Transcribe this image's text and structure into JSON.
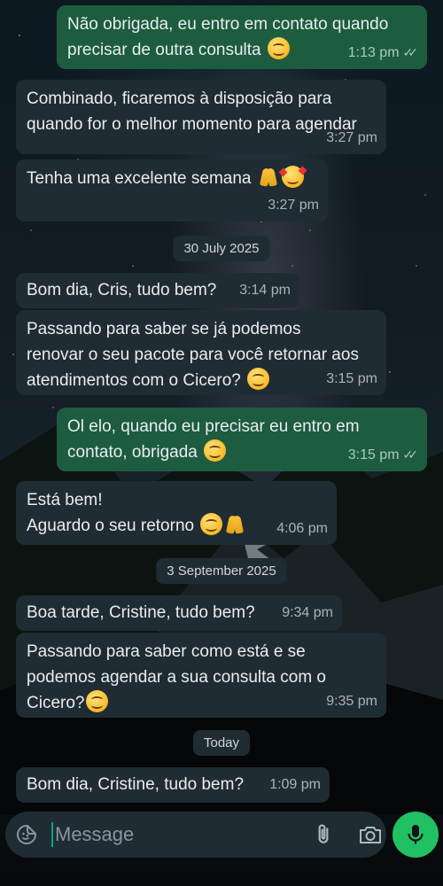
{
  "messages": [
    {
      "dir": "out",
      "text": "Não obrigada, eu entro em contato quando\nprecisar de outra consulta",
      "emojis": [
        "smile"
      ],
      "time": "1:13 pm",
      "read": true
    },
    {
      "dir": "in",
      "text": "Combinado, ficaremos à disposição para\nquando for o melhor momento para agendar",
      "emojis": [],
      "time": "3:27 pm"
    },
    {
      "dir": "in",
      "text": "Tenha uma excelente semana",
      "emojis": [
        "pray",
        "love"
      ],
      "time": "3:27 pm"
    },
    {
      "dir": "in",
      "text": "Bom dia, Cris, tudo bem?",
      "emojis": [],
      "time": "3:14 pm"
    },
    {
      "dir": "in",
      "text": "Passando para saber se já podemos\nrenovar o seu pacote para você retornar aos\natendimentos com o Cicero?",
      "emojis": [
        "smile"
      ],
      "time": "3:15 pm"
    },
    {
      "dir": "out",
      "text": "Ol elo, quando eu precisar eu entro em\ncontato, obrigada",
      "emojis": [
        "smile"
      ],
      "time": "3:15 pm",
      "read": true
    },
    {
      "dir": "in",
      "text": "Está bem!\nAguardo o seu retorno",
      "emojis": [
        "smile",
        "pray"
      ],
      "time": "4:06 pm"
    },
    {
      "dir": "in",
      "text": "Boa tarde, Cristine, tudo bem?",
      "emojis": [],
      "time": "9:34 pm"
    },
    {
      "dir": "in",
      "text": "Passando para saber como está e se\npodemos agendar a sua consulta com o\nCicero?",
      "emojis": [
        "smile"
      ],
      "time": "9:35 pm"
    },
    {
      "dir": "in",
      "text": "Bom dia, Cristine, tudo bem?",
      "emojis": [],
      "time": "1:09 pm"
    }
  ],
  "date_chips": [
    "30 July 2025",
    "3 September 2025",
    "Today"
  ],
  "input": {
    "placeholder": "Message"
  },
  "colors": {
    "incoming": "#202c33",
    "outgoing": "#1d5c3f",
    "accent": "#21c063"
  },
  "icons": {
    "sticker": "sticker-icon",
    "attach": "paperclip-icon",
    "camera": "camera-icon",
    "mic": "mic-icon",
    "read": "double-check-icon"
  }
}
